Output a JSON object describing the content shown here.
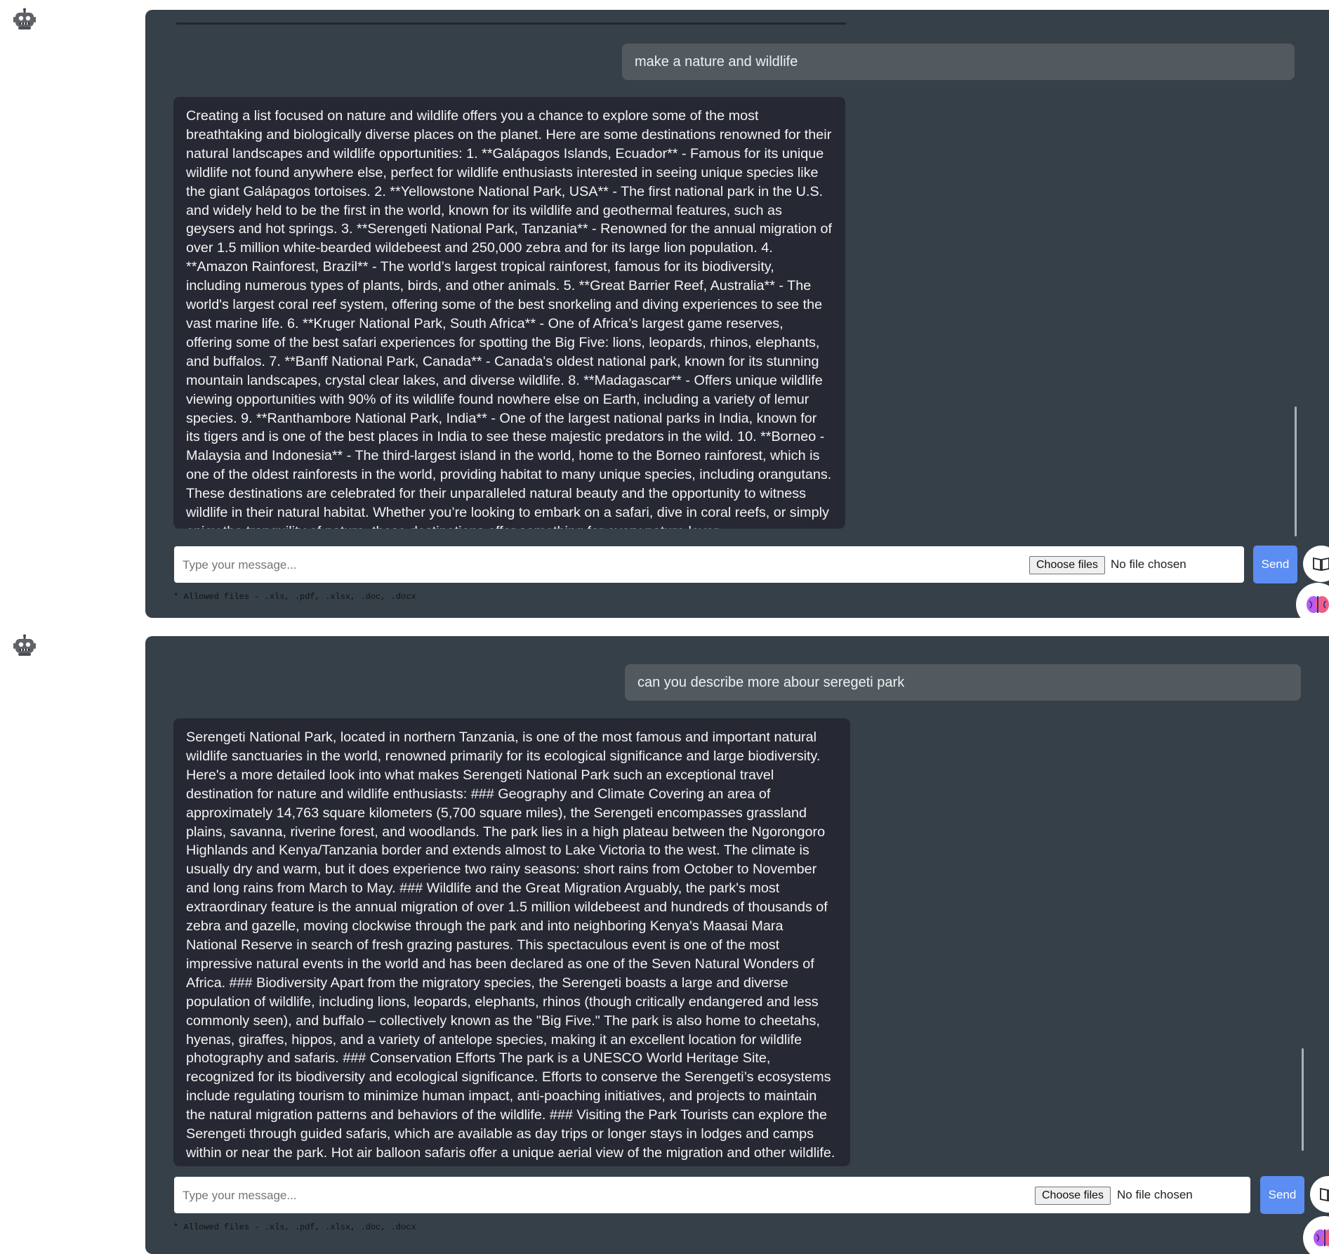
{
  "conversation_1": {
    "user_message": "make a nature and wildlife",
    "bot_message": "Creating a list focused on nature and wildlife offers you a chance to explore some of the most breathtaking and biologically diverse places on the planet. Here are some destinations renowned for their natural landscapes and wildlife opportunities: 1. **Galápagos Islands, Ecuador** - Famous for its unique wildlife not found anywhere else, perfect for wildlife enthusiasts interested in seeing unique species like the giant Galápagos tortoises. 2. **Yellowstone National Park, USA** - The first national park in the U.S. and widely held to be the first in the world, known for its wildlife and geothermal features, such as geysers and hot springs. 3. **Serengeti National Park, Tanzania** - Renowned for the annual migration of over 1.5 million white-bearded wildebeest and 250,000 zebra and for its large lion population. 4. **Amazon Rainforest, Brazil** - The world’s largest tropical rainforest, famous for its biodiversity, including numerous types of plants, birds, and other animals. 5. **Great Barrier Reef, Australia** - The world's largest coral reef system, offering some of the best snorkeling and diving experiences to see the vast marine life. 6. **Kruger National Park, South Africa** - One of Africa’s largest game reserves, offering some of the best safari experiences for spotting the Big Five: lions, leopards, rhinos, elephants, and buffalos. 7. **Banff National Park, Canada** - Canada's oldest national park, known for its stunning mountain landscapes, crystal clear lakes, and diverse wildlife. 8. **Madagascar** - Offers unique wildlife viewing opportunities with 90% of its wildlife found nowhere else on Earth, including a variety of lemur species. 9. **Ranthambore National Park, India** - One of the largest national parks in India, known for its tigers and is one of the best places in India to see these majestic predators in the wild. 10. **Borneo - Malaysia and Indonesia** - The third-largest island in the world, home to the Borneo rainforest, which is one of the oldest rainforests in the world, providing habitat to many unique species, including orangutans. These destinations are celebrated for their unparalleled natural beauty and the opportunity to witness wildlife in their natural habitat. Whether you’re looking to embark on a safari, dive in coral reefs, or simply enjoy the tranquility of nature, these destinations offer something for every nature lover.",
    "input_placeholder": "Type your message...",
    "choose_files_label": "Choose files",
    "file_status": "No file chosen",
    "send_label": "Send",
    "allowed_note": "* Allowed files - .xls, .pdf, .xlsx, .doc, .docx"
  },
  "conversation_2": {
    "user_message": "can you describe more abour seregeti park",
    "bot_message": "Serengeti National Park, located in northern Tanzania, is one of the most famous and important natural wildlife sanctuaries in the world, renowned primarily for its ecological significance and large biodiversity. Here's a more detailed look into what makes Serengeti National Park such an exceptional travel destination for nature and wildlife enthusiasts: ### Geography and Climate Covering an area of approximately 14,763 square kilometers (5,700 square miles), the Serengeti encompasses grassland plains, savanna, riverine forest, and woodlands. The park lies in a high plateau between the Ngorongoro Highlands and Kenya/Tanzania border and extends almost to Lake Victoria to the west. The climate is usually dry and warm, but it does experience two rainy seasons: short rains from October to November and long rains from March to May. ### Wildlife and the Great Migration Arguably, the park's most extraordinary feature is the annual migration of over 1.5 million wildebeest and hundreds of thousands of zebra and gazelle, moving clockwise through the park and into neighboring Kenya's Maasai Mara National Reserve in search of fresh grazing pastures. This spectaculous event is one of the most impressive natural events in the world and has been declared as one of the Seven Natural Wonders of Africa. ### Biodiversity Apart from the migratory species, the Serengeti boasts a large and diverse population of wildlife, including lions, leopards, elephants, rhinos (though critically endangered and less commonly seen), and buffalo – collectively known as the \"Big Five.\" The park is also home to cheetahs, hyenas, giraffes, hippos, and a variety of antelope species, making it an excellent location for wildlife photography and safaris. ### Conservation Efforts The park is a UNESCO World Heritage Site, recognized for its biodiversity and ecological significance. Efforts to conserve the Serengeti’s ecosystems include regulating tourism to minimize human impact, anti-poaching initiatives, and projects to maintain the natural migration patterns and behaviors of the wildlife. ### Visiting the Park Tourists can explore the Serengeti through guided safaris, which are available as day trips or longer stays in lodges and camps within or near the park. Hot air balloon safaris offer a unique aerial view of the migration and other wildlife. The best time to visit depends on what you wish to see: the main wildebeest migration typically occurs from December to July, while to witness the wildebeest calving, late",
    "input_placeholder": "Type your message...",
    "choose_files_label": "Choose files",
    "file_status": "No file chosen",
    "send_label": "Send",
    "allowed_note": "* Allowed files - .xls, .pdf, .xlsx, .doc, .docx"
  },
  "icons": {
    "bot_avatar": "robot-icon",
    "knowledge": "book-icon",
    "ai_model": "brain-icon"
  },
  "colors": {
    "panel_bg": "#364049",
    "bot_bubble": "#262933",
    "user_bubble": "#535a5f",
    "send_button": "#5b8df2"
  }
}
